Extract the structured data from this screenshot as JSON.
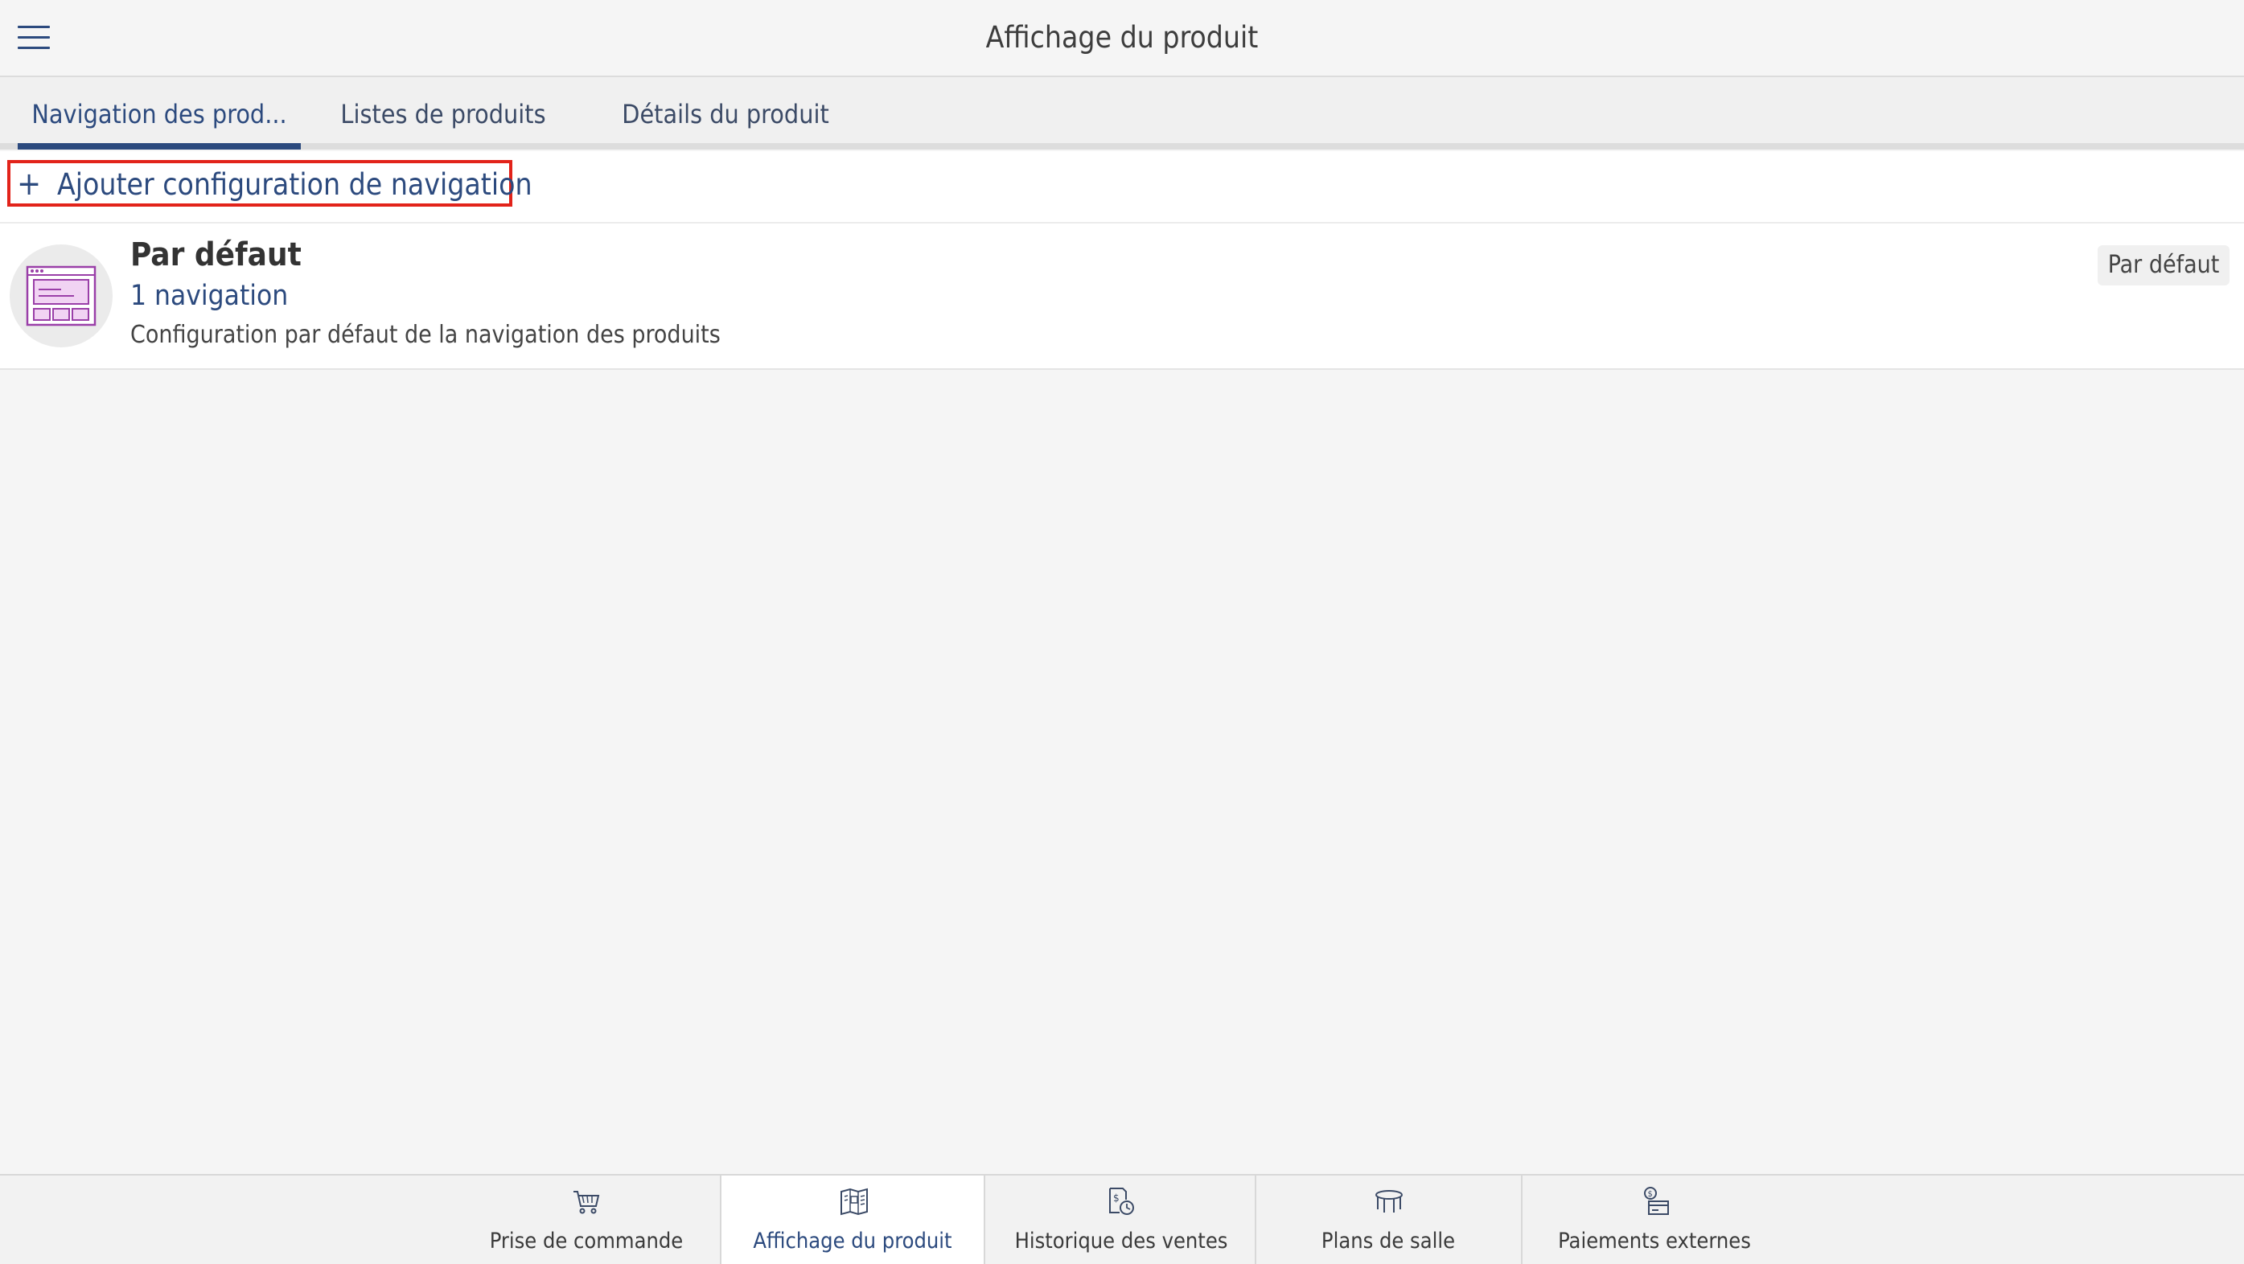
{
  "header": {
    "title": "Affichage du produit",
    "menu_icon": "hamburger-menu-icon"
  },
  "tabs": [
    {
      "label": "Navigation des prod...",
      "active": true
    },
    {
      "label": "Listes de produits",
      "active": false
    },
    {
      "label": "Détails du produit",
      "active": false
    }
  ],
  "add_action": {
    "icon": "plus-icon",
    "plus_symbol": "+",
    "label": "Ajouter configuration de navigation"
  },
  "items": [
    {
      "icon": "layout-config-icon",
      "title": "Par défaut",
      "subtitle": "1 navigation",
      "description": "Configuration par défaut de la navigation des produits",
      "badge": "Par défaut"
    }
  ],
  "bottom_nav": [
    {
      "label": "Prise de commande",
      "icon": "cart-icon",
      "active": false
    },
    {
      "label": "Affichage du produit",
      "icon": "product-display-icon",
      "active": true
    },
    {
      "label": "Historique des ventes",
      "icon": "sales-history-icon",
      "active": false
    },
    {
      "label": "Plans de salle",
      "icon": "table-icon",
      "active": false
    },
    {
      "label": "Paiements externes",
      "icon": "external-payment-icon",
      "active": false
    }
  ],
  "colors": {
    "primary": "#2c4a7e",
    "highlight_border": "#e2231a",
    "icon_purple": "#9a3fa8",
    "icon_purple_fill": "#f1d3f3"
  }
}
